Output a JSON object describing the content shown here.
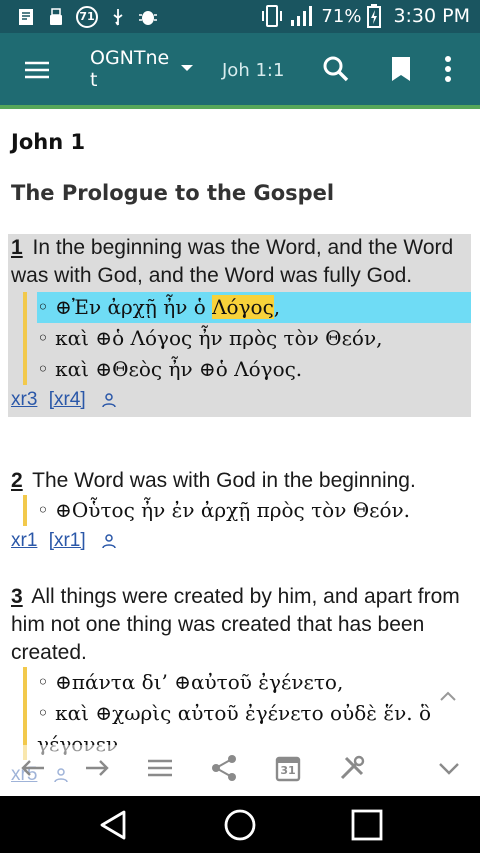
{
  "status_bar": {
    "battery": "71%",
    "time": "3:30 PM",
    "badge_number": "71"
  },
  "toolbar": {
    "title": "OGNTnet",
    "reference": "Joh 1:1"
  },
  "chapter_title": "John 1",
  "section_heading": "The Prologue to the Gospel",
  "verses": [
    {
      "number": "1",
      "text": "In the beginning was the Word, and the Word was with God, and the Word was fully God.",
      "greek": [
        {
          "pre": "◦ ⊕Ἐν ἀρχῇ ἦν ὁ ",
          "hl": "Λόγος",
          "post": ","
        },
        {
          "pre": "◦ καὶ ⊕ὁ Λόγος ἦν πρὸς τὸν Θεόν,",
          "hl": "",
          "post": ""
        },
        {
          "pre": "◦ καὶ ⊕Θεὸς ἦν ⊕ὁ Λόγος.",
          "hl": "",
          "post": ""
        }
      ],
      "xrefs": [
        "xr3",
        "[xr4]"
      ]
    },
    {
      "number": "2",
      "text": "The Word was with God in the beginning.",
      "greek": [
        {
          "pre": "◦ ⊕Οὗτος ἦν ἐν ἀρχῇ πρὸς τὸν Θεόν.",
          "hl": "",
          "post": ""
        }
      ],
      "xrefs": [
        "xr1",
        "[xr1]"
      ]
    },
    {
      "number": "3",
      "text": "All things were created by him, and apart from him not one thing was created that has been created.",
      "greek": [
        {
          "pre": "◦ ⊕πάντα δι’ ⊕αὐτοῦ ἐγένετο,",
          "hl": "",
          "post": ""
        },
        {
          "pre": "◦ καὶ ⊕χωρὶς αὐτοῦ ἐγένετο οὐδὲ ἕν. ὃ",
          "hl": "",
          "post": ""
        },
        {
          "pre": "γέγονεν",
          "hl": "",
          "post": ""
        }
      ],
      "xrefs": [
        "xr5"
      ]
    }
  ],
  "calendar_day": "31",
  "colors": {
    "status_bar": "#1a5560",
    "toolbar": "#1f6b72",
    "toolbar_accent": "#57a75a",
    "verse_highlight": "#dcdcdc",
    "greek_line_highlight": "#6fdcf5",
    "word_highlight": "#f8d23a",
    "greek_bar": "#f2c94c",
    "link": "#2a57a8"
  }
}
